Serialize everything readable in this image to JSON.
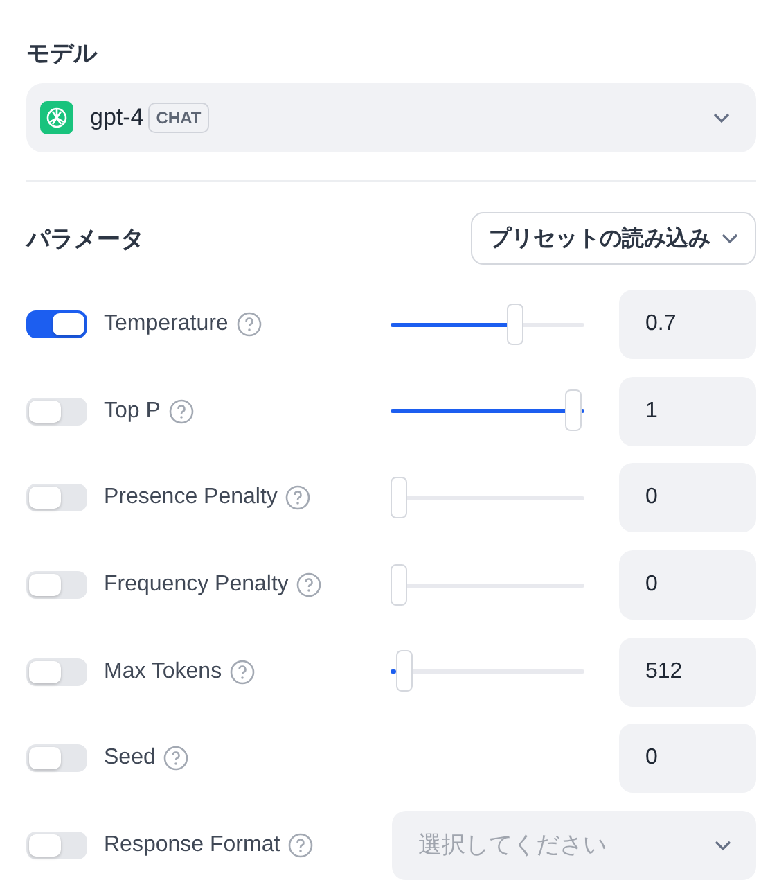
{
  "model": {
    "label": "モデル",
    "name": "gpt-4",
    "badge": "CHAT"
  },
  "parameters": {
    "label": "パラメータ",
    "preset_button": "プリセットの読み込み",
    "rows": [
      {
        "kind": "slider",
        "name": "Temperature",
        "on": true,
        "level": 0.67,
        "value": "0.7"
      },
      {
        "kind": "slider",
        "name": "Top P",
        "on": false,
        "level": 1,
        "value": "1"
      },
      {
        "kind": "slider",
        "name": "Presence Penalty",
        "on": false,
        "level": 0,
        "value": "0"
      },
      {
        "kind": "slider",
        "name": "Frequency Penalty",
        "on": false,
        "level": 0,
        "value": "0"
      },
      {
        "kind": "slider",
        "name": "Max Tokens",
        "on": false,
        "level": 0.03,
        "value": "512"
      },
      {
        "kind": "number",
        "name": "Seed",
        "on": false,
        "value": "0"
      },
      {
        "kind": "select",
        "name": "Response Format",
        "on": false,
        "placeholder": "選択してください"
      }
    ]
  }
}
